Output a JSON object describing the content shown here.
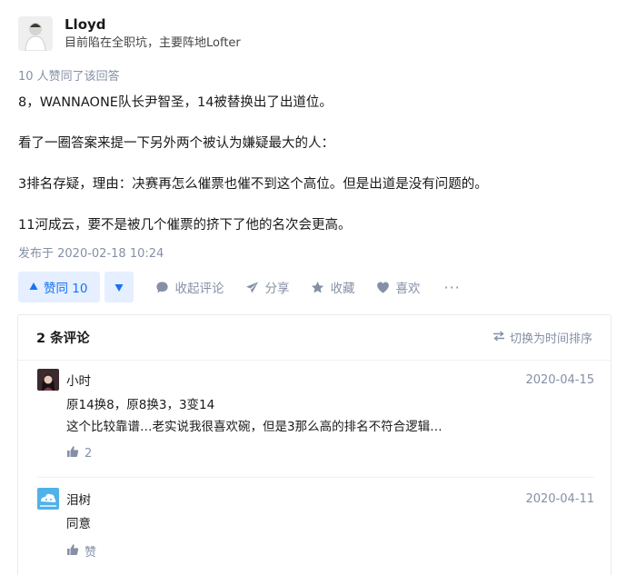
{
  "author": {
    "name": "Lloyd",
    "headline": "目前陷在全职坑，主要阵地Lofter"
  },
  "answer": {
    "voters_text": "10 人赞同了该回答",
    "paragraphs": [
      "8，WANNAONE队长尹智圣，14被替换出了出道位。",
      "看了一圈答案来提一下另外两个被认为嫌疑最大的人：",
      "3排名存疑，理由：决赛再怎么催票也催不到这个高位。但是出道是没有问题的。",
      "11河成云，要不是被几个催票的挤下了他的名次会更高。"
    ],
    "published": "发布于 2020-02-18 10:24"
  },
  "actions": {
    "vote_up_label": "赞同 10",
    "collapse_comments": "收起评论",
    "share": "分享",
    "favorite": "收藏",
    "like": "喜欢",
    "more": "···"
  },
  "comments": {
    "count_label": "2 条评论",
    "switch_sort": "切换为时间排序",
    "items": [
      {
        "author": "小时",
        "date": "2020-04-15",
        "lines": [
          "原14换8，原8换3，3变14",
          "这个比较靠谱…老实说我很喜欢碗，但是3那么高的排名不符合逻辑…"
        ],
        "likes": "2"
      },
      {
        "author": "泪树",
        "date": "2020-04-11",
        "lines": [
          "同意"
        ],
        "likes": "赞"
      }
    ]
  },
  "colors": {
    "accent": "#1772f6",
    "accent_bg": "#e5efff",
    "muted": "#8590a6"
  }
}
